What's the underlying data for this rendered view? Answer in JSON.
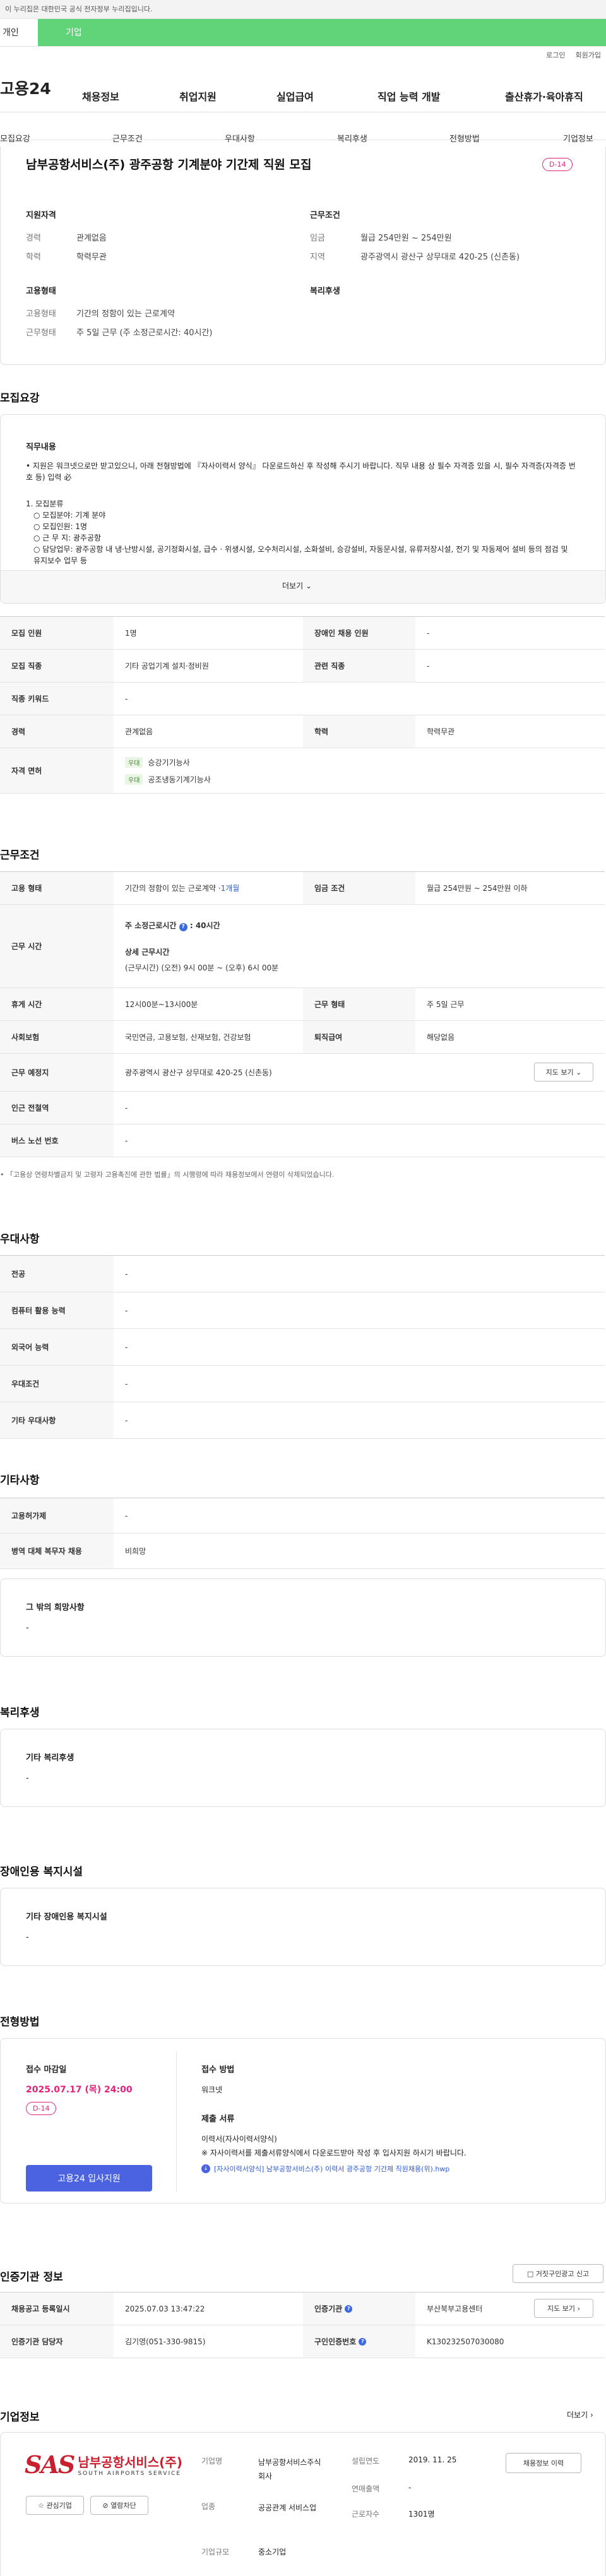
{
  "banner": "이 누리집은 대한민국 공식 전자정부 누리집입니다.",
  "tabs": [
    "개인",
    "기업"
  ],
  "util": [
    "로그인",
    "회원가입"
  ],
  "logo": "고용24",
  "gnb": [
    "채용정보",
    "취업지원",
    "실업급여",
    "직업 능력 개발",
    "출산휴가·육아휴직"
  ],
  "snb": [
    "모집요강",
    "근무조건",
    "우대사항",
    "복리후생",
    "전형방법",
    "기업정보"
  ],
  "job": {
    "title": "남부공항서비스(주) 광주공항 기계분야 기간제 직원 모집",
    "dday": "D-14",
    "qual_head": "지원자격",
    "cond_head": "근무조건",
    "emp_head": "고용형태",
    "welfare_head": "복리후생",
    "exp_label": "경력",
    "exp": "관계없음",
    "edu_label": "학력",
    "edu": "학력무관",
    "wage_label": "임금",
    "wage": "월급 254만원 ~ 254만원",
    "region_label": "지역",
    "region": "광주광역시 광산구 상무대로 420-25 (신촌동)",
    "type_label": "고용형태",
    "type": "기간의 정함이 있는 근로계약",
    "worktype_label": "근무형태",
    "worktype": "주 5일 근무 (주 소정근로시간: 40시간)"
  },
  "recruit": {
    "head": "모집요강",
    "duty_head": "직무내용",
    "line1": "• 지원은 워크넷으로만 받고있으니, 아래 전형방법에 『자사이력서 양식』 다운로드하신 후 작성해 주시기 바랍니다. 직무 내용 상 필수 자격증 있을 시, 필수 자격증(자격증 번호 등) 입력 必",
    "line2": "1. 모집분류",
    "line3": "  ○ 모집분야: 기계 분야",
    "line4": "  ○ 모집인원: 1명",
    "line5": "  ○ 근 무 지: 광주공항",
    "line6": "  ○ 담당업무: 광주공항 내 냉·난방시설, 공기정화시설, 급수 · 위생시설, 오수처리시설, 소화설비, 승강설비, 자동문시설, 유류저장시설, 전기 및 자동제어 설비 등의 점검 및 유지보수 업무 등",
    "more": "더보기"
  },
  "recruit_table": {
    "count_label": "모집 인원",
    "count": "1명",
    "disabled_label": "장애인 채용 인원",
    "disabled": "-",
    "job_label": "모집 직종",
    "job": "기타 공업기계 설치·정비원",
    "related_label": "관련 직종",
    "related": "-",
    "kw_label": "직종 키워드",
    "kw": "-",
    "exp_label": "경력",
    "exp": "관계없음",
    "edu_label": "학력",
    "edu": "학력무관",
    "lic_label": "자격 면허",
    "lic_tag": "우대",
    "lic1": "승강기기능사",
    "lic2": "공조냉동기계기능사"
  },
  "cond": {
    "head": "근무조건",
    "type_label": "고용 형태",
    "type": "기간의 정함이 있는 근로계약 · ",
    "type_link": "1개월",
    "wage_label": "임금 조건",
    "wage": "월급 254만원 ~ 254만원 이하",
    "hours_label": "근무 시간",
    "hours_sum": "주 소정근로시간",
    "hours_val": ": 40시간",
    "detail_head": "상세 근무시간",
    "detail": "(근무시간) (오전) 9시 00분 ~ (오후) 6시 00분",
    "break_label": "휴게 시간",
    "break": "12시00분~13시00분",
    "form_label": "근무 형태",
    "form": "주 5일 근무",
    "ins_label": "사회보험",
    "ins": "국민연금, 고용보험, 산재보험, 건강보험",
    "sev_label": "퇴직급여",
    "sev": "해당없음",
    "place_label": "근무 예정지",
    "place": "광주광역시 광산구 상무대로 420-25 (신촌동)",
    "map_btn": "지도 보기",
    "station_label": "인근 전철역",
    "station": "-",
    "bus_label": "버스 노선 번호",
    "bus": "-",
    "notice": "「고용상 연령차별금지 및 고령자 고용촉진에 관한 법률」의 시행령에 따라 채용정보에서 연령이 삭제되었습니다."
  },
  "pref": {
    "head": "우대사항",
    "rows": [
      [
        "전공",
        "-"
      ],
      [
        "컴퓨터 활용 능력",
        "-"
      ],
      [
        "외국어 능력",
        "-"
      ],
      [
        "우대조건",
        "-"
      ],
      [
        "기타 우대사항",
        "-"
      ]
    ]
  },
  "etc": {
    "head": "기타사항",
    "rows": [
      [
        "고용허가제",
        "-"
      ],
      [
        "병역 대체 복무자 채용",
        "비희망"
      ]
    ],
    "box_head": "그 밖의 희망사항",
    "box_val": "-"
  },
  "welfare": {
    "head": "복리후생",
    "box_head": "기타 복리후생",
    "box_val": "-"
  },
  "facility": {
    "head": "장애인용 복지시설",
    "box_head": "기타 장애인용 복지시설",
    "box_val": "-"
  },
  "screen": {
    "head": "전형방법",
    "deadline_head": "접수 마감일",
    "deadline": "2025.07.17 (목) 24:00",
    "dday": "D-14",
    "method_head": "접수 방법",
    "method": "워크넷",
    "docs_head": "제출 서류",
    "docs1": "이력서(자사이력서양식)",
    "docs2": "※ 자사이력서를 제출서류양식에서 다운로드받아 작성 후 입사지원 하시기 바랍니다.",
    "file": "[자사이력서양식] 남부공항서비스(주) 이력서 광주공항 기간제 직원채용(위).hwp",
    "apply": "고용24 입사지원"
  },
  "cert": {
    "head": "인증기관 정보",
    "report": "거짓구인광고 신고",
    "date_label": "채용공고 등록일시",
    "date": "2025.07.03 13:47:22",
    "agency_label": "인증기관",
    "agency": "부산북부고용센터",
    "manager_label": "인증기관 담당자",
    "manager": "김기영(051-330-9815)",
    "cert_no_label": "구인인증번호",
    "cert_no": "K130232507030080",
    "map_btn": "지도 보기"
  },
  "company": {
    "head": "기업정보",
    "more": "더보기",
    "logo_big": "SAS",
    "logo_name": "남부공항서비스(주)",
    "logo_sub": "SOUTH AIRPORTS SERVICE",
    "fav": "관심기업",
    "block": "열람차단",
    "name_label": "기업명",
    "name": "남부공항서비스주식회사",
    "year_label": "설립연도",
    "year": "2019. 11. 25",
    "sales_label": "연매출액",
    "sales": "-",
    "biz_label": "업종",
    "biz": "공공관계 서비스업",
    "emp_label": "근로자수",
    "emp": "1301명",
    "size_label": "기업규모",
    "size": "중소기업",
    "info_btn": "채용정보 이력"
  }
}
